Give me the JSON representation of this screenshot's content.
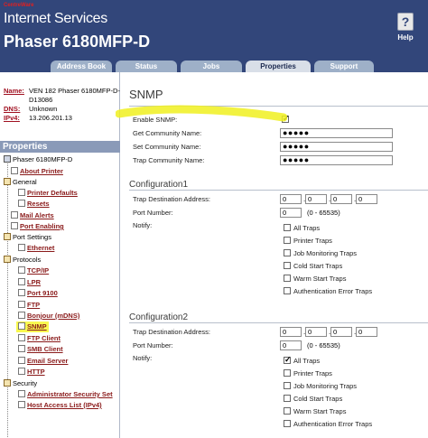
{
  "header": {
    "brand_top": "CentreWare",
    "brand": "Internet Services",
    "model": "Phaser 6180MFP-D",
    "help_label": "Help",
    "help_icon": "help-question-icon"
  },
  "tabs": [
    {
      "label": "Address Book"
    },
    {
      "label": "Status"
    },
    {
      "label": "Jobs"
    },
    {
      "label": "Properties"
    },
    {
      "label": "Support"
    }
  ],
  "info": {
    "name_label": "Name:",
    "name_value_1": "VEN 182 Phaser 6180MFP-D-",
    "name_value_2": "D13086",
    "dns_label": "DNS:",
    "dns_value": "Unknown",
    "ipv4_label": "IPv4:",
    "ipv4_value": "13.206.201.13"
  },
  "properties_heading": "Properties",
  "tree": [
    {
      "label": "Phaser 6180MFP-D"
    },
    {
      "label": "About Printer"
    },
    {
      "label": "General"
    },
    {
      "label": "Printer Defaults"
    },
    {
      "label": "Resets"
    },
    {
      "label": "Mail Alerts"
    },
    {
      "label": "Port Enabling"
    },
    {
      "label": "Port Settings"
    },
    {
      "label": "Ethernet"
    },
    {
      "label": "Protocols"
    },
    {
      "label": "TCP/IP"
    },
    {
      "label": "LPR"
    },
    {
      "label": "Port 9100"
    },
    {
      "label": "FTP"
    },
    {
      "label": "Bonjour (mDNS)"
    },
    {
      "label": "SNMP"
    },
    {
      "label": "FTP Client"
    },
    {
      "label": "SMB Client"
    },
    {
      "label": "Email Server"
    },
    {
      "label": "HTTP"
    },
    {
      "label": "Security"
    },
    {
      "label": "Administrator Security Set"
    },
    {
      "label": "Host Access List (IPv4)"
    }
  ],
  "main": {
    "title": "SNMP",
    "enable_snmp_label": "Enable SNMP:",
    "enable_snmp_checked": true,
    "get_community_label": "Get Community Name:",
    "get_community_value": "●●●●●",
    "set_community_label": "Set Community Name:",
    "set_community_value": "●●●●●",
    "trap_community_label": "Trap Community Name:",
    "trap_community_value": "●●●●●"
  },
  "config1": {
    "title": "Configuration1",
    "trap_dest_label": "Trap Destination Address:",
    "ip": [
      "0",
      "0",
      "0",
      "0"
    ],
    "port_label": "Port Number:",
    "port_value": "0",
    "port_hint": "(0 - 65535)",
    "notify_label": "Notify:",
    "options": [
      "All Traps",
      "Printer Traps",
      "Job Monitoring Traps",
      "Cold Start Traps",
      "Warm Start Traps",
      "Authentication Error Traps"
    ]
  },
  "config2": {
    "title": "Configuration2",
    "trap_dest_label": "Trap Destination Address:",
    "ip": [
      "0",
      "0",
      "0",
      "0"
    ],
    "port_label": "Port Number:",
    "port_value": "0",
    "port_hint": "(0 - 65535)",
    "notify_label": "Notify:",
    "options": [
      "All Traps",
      "Printer Traps",
      "Job Monitoring Traps",
      "Cold Start Traps",
      "Warm Start Traps",
      "Authentication Error Traps"
    ]
  },
  "colors": {
    "header_bg": "#32467a",
    "tab_bg": "#9eb0c8",
    "highlight": "#f0f020",
    "link": "#8a1a1a"
  }
}
